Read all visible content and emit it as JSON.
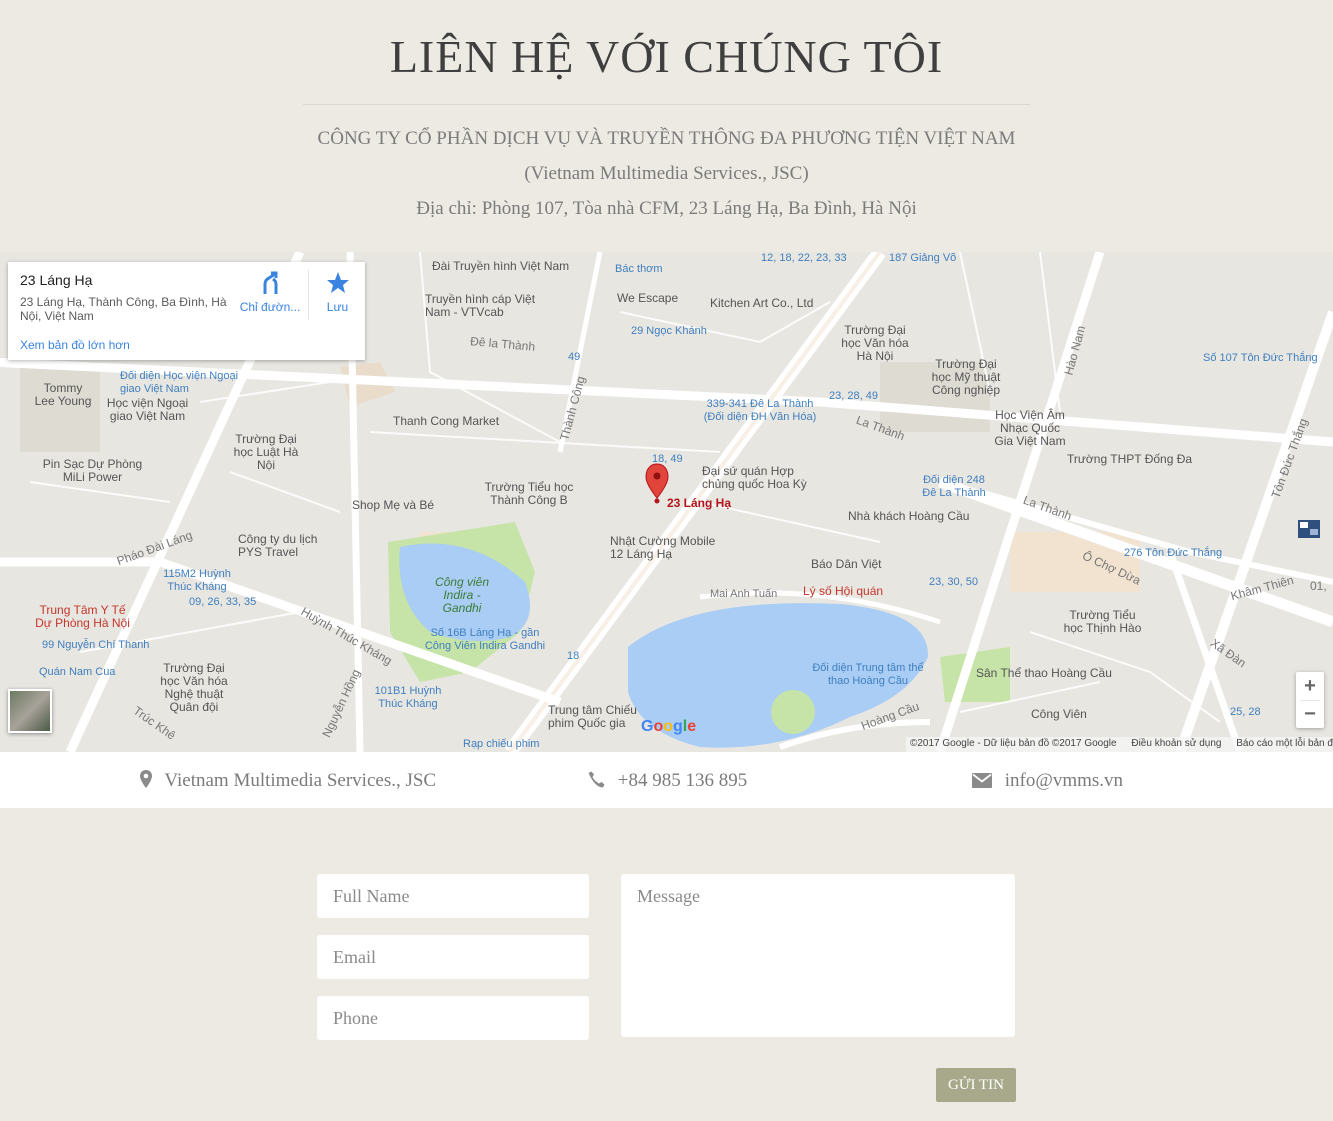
{
  "header": {
    "title": "LIÊN HỆ VỚI CHÚNG TÔI",
    "company_vi": "CÔNG TY CỔ PHẦN DỊCH VỤ VÀ TRUYỀN THÔNG ĐA PHƯƠNG TIỆN VIỆT NAM",
    "company_en": "(Vietnam Multimedia Services., JSC)",
    "address": "Địa chỉ: Phòng 107, Tòa nhà CFM, 23 Láng Hạ, Ba Đình, Hà Nội"
  },
  "map": {
    "infocard": {
      "place_name": "23 Láng Hạ",
      "place_address": "23 Láng Hạ, Thành Công, Ba Đình, Hà Nội, Việt Nam",
      "directions_label": "Chỉ đườn...",
      "save_label": "Lưu",
      "larger_map_label": "Xem bản đồ lớn hơn"
    },
    "pin_label": "23 Láng Hạ",
    "zoom_in": "+",
    "zoom_out": "−",
    "google_logo": "Google",
    "attribution": {
      "copyright": "©2017 Google - Dữ liệu bản đồ ©2017 Google",
      "terms": "Điều khoản sử dụng",
      "report": "Báo cáo một lỗi bản đồ"
    },
    "labels": {
      "dai_truyen_hinh": "Đài Truyền hình Việt Nam",
      "truyen_hinh_cap": "Truyền hình cáp Việt Nam - VTVcab",
      "bac_thom": "Bác thơm",
      "we_escape": "We Escape",
      "kitchen_art": "Kitchen Art Co., Ltd",
      "bus_12_18": "12, 18, 22, 23, 33",
      "giang_vo": "187 Giảng Võ",
      "ngoc_khanh": "29 Ngọc Khánh",
      "de_la_thanh": "Đê la Thành",
      "bus_49": "49",
      "dh_van_hoa": "Trường Đại học Văn hóa Hà Nội",
      "dh_my_thuat": "Trường Đại học Mỹ thuật Công nghiệp",
      "ton_duc_thang_107": "Số 107 Tôn Đức Thắng",
      "hao_nam": "Hào Nam",
      "tommy": "Tommy Lee Young",
      "doi_dien_hv": "Đối diện Học viện Ngoại giao Việt Nam",
      "hv_ngoai_giao": "Học viện Ngoại giao Việt Nam",
      "thanh_cong_market": "Thanh Cong Market",
      "thanh_cong": "Thành Công",
      "la_thanh_339": "339-341 Đê La Thành (Đối diện ĐH Văn Hóa)",
      "bus_23_28": "23, 28, 49",
      "la_thanh": "La Thành",
      "hv_am_nhac": "Học Viện Âm Nhạc Quốc Gia Việt Nam",
      "dh_luat": "Trường Đại học Luật Hà Nội",
      "pin_sac": "Pin Sạc Dự Phòng MiLi Power",
      "bus_18_49": "18, 49",
      "dsq_hoa_ky": "Đại sứ quán Hợp chủng quốc Hoa Kỳ",
      "thpt_dong_da": "Trường THPT Đống Đa",
      "th_thanh_cong": "Trường Tiểu học Thành Công B",
      "shop_me_be": "Shop Mẹ và Bé",
      "doi_dien_248": "Đối diện 248 Đê La Thành",
      "nha_khach": "Nhà khách Hoàng Cầu",
      "la_thanh_2": "La Thành",
      "pyx_travel": "Công ty du lịch PYS Travel",
      "nhat_cuong": "Nhật Cường Mobile 12 Láng Hạ",
      "phao_dai_lang": "Pháo Đài Láng",
      "bao_dan_viet": "Báo Dân Việt",
      "o_cho_dua": "Ô Chợ Dừa",
      "ton_duc_thang_276": "276 Tôn Đức Thắng",
      "huynh_115": "115M2 Huỳnh Thúc Kháng",
      "bus_09": "09, 26, 33, 35",
      "cong_vien_indira": "Công viên Indira - Gandhi",
      "ly_so": "Lý số Hội quán",
      "bus_23_30": "23, 30, 50",
      "kham_thien": "Khâm Thiên",
      "trung_tam_y_te": "Trung Tâm Y Tế Dự Phòng Hà Nội",
      "nguyen_chi_thanh": "99 Nguyễn Chí Thanh",
      "huynh_thuc_khang": "Huỳnh Thúc Kháng",
      "so_16b": "Số 16B Láng Hạ - gần Công Viên Indira Gandhi",
      "mai_anh_tuan": "Mai Anh Tuấn",
      "doi_dien_trung_tam": "Đối diện Trung tâm thể thao Hoàng Cầu",
      "th_thinh_hao": "Trường Tiểu học Thịnh Hào",
      "xa_dan": "Xã Đàn",
      "quan_nam_cua": "Quán Nam Cua",
      "dh_nghe_thuat": "Trường Đại học Văn hóa Nghệ thuật Quân đội",
      "san_the_thao": "Sân Thể thao Hoàng Cầu",
      "nguyen_hong": "Nguyễn Hồng",
      "bus_18": "18",
      "huynh_101": "101B1 Huỳnh Thúc Kháng",
      "trung_tam_chieu": "Trung tâm Chiếu phim Quốc gia",
      "hoang_cau": "Hoàng Cầu",
      "cong_vien": "Công Viên",
      "bus_25": "25, 28",
      "truc_khe": "Trúc Khê",
      "rap_chieu": "Rạp chiếu phim",
      "ton_duc_thang": "Tôn Đức Thắng",
      "bus_01": "01,",
      "hoang_cau_2": "Hoàng Cầu",
      "dieu": "Điều"
    }
  },
  "contact": {
    "company": "Vietnam Multimedia Services., JSC",
    "phone": "+84 985 136 895",
    "email": "info@vmms.vn"
  },
  "form": {
    "name_placeholder": "Full Name",
    "email_placeholder": "Email",
    "phone_placeholder": "Phone",
    "message_placeholder": "Message",
    "submit_label": "GỬI TIN"
  },
  "colors": {
    "background": "#edeae3",
    "submit_button": "#a7a98a",
    "map_link": "#3a84df",
    "pin": "#e0443a"
  }
}
